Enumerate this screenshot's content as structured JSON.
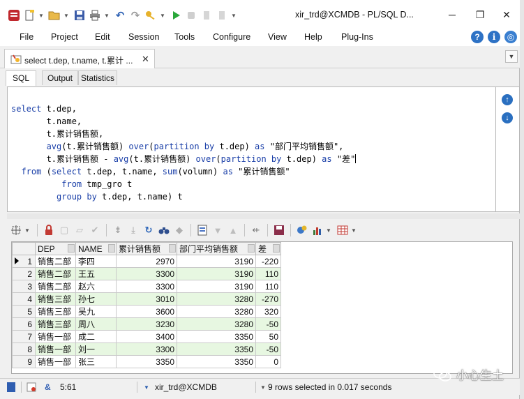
{
  "window": {
    "title": "xir_trd@XCMDB - PL/SQL D...",
    "minimize": "─",
    "restore": "❐",
    "close": "✕"
  },
  "menu": {
    "items": [
      "File",
      "Project",
      "Edit",
      "Session",
      "Tools",
      "Configure",
      "View",
      "Help",
      "Plug-Ins"
    ]
  },
  "document_tab": {
    "label": "select t.dep, t.name, t.累计 ...",
    "close": "✕"
  },
  "subtabs": [
    "SQL",
    "Output",
    "Statistics"
  ],
  "sql_lines": [
    "select t.dep,",
    "       t.name,",
    "       t.累计销售额,",
    "       avg(t.累计销售额) over(partition by t.dep) as \"部门平均销售额\",",
    "       t.累计销售额 - avg(t.累计销售额) over(partition by t.dep) as \"差\"",
    "  from (select t.dep, t.name, sum(volumn) as \"累计销售额\"",
    "          from tmp_gro t",
    "         group by t.dep, t.name) t"
  ],
  "grid": {
    "columns": [
      "DEP",
      "NAME",
      "累计销售额",
      "部门平均销售额",
      "差"
    ],
    "rows": [
      [
        "1",
        "销售二部",
        "李四",
        "2970",
        "3190",
        "-220"
      ],
      [
        "2",
        "销售二部",
        "王五",
        "3300",
        "3190",
        "110"
      ],
      [
        "3",
        "销售二部",
        "赵六",
        "3300",
        "3190",
        "110"
      ],
      [
        "4",
        "销售三部",
        "孙七",
        "3010",
        "3280",
        "-270"
      ],
      [
        "5",
        "销售三部",
        "吴九",
        "3600",
        "3280",
        "320"
      ],
      [
        "6",
        "销售三部",
        "周八",
        "3230",
        "3280",
        "-50"
      ],
      [
        "7",
        "销售一部",
        "成二",
        "3400",
        "3350",
        "50"
      ],
      [
        "8",
        "销售一部",
        "刘一",
        "3300",
        "3350",
        "-50"
      ],
      [
        "9",
        "销售一部",
        "张三",
        "3350",
        "3350",
        "0"
      ]
    ]
  },
  "status": {
    "position": "5:61",
    "connection": "xir_trd@XCMDB",
    "message": "9 rows selected in 0.017 seconds"
  },
  "watermark": "小心生土"
}
